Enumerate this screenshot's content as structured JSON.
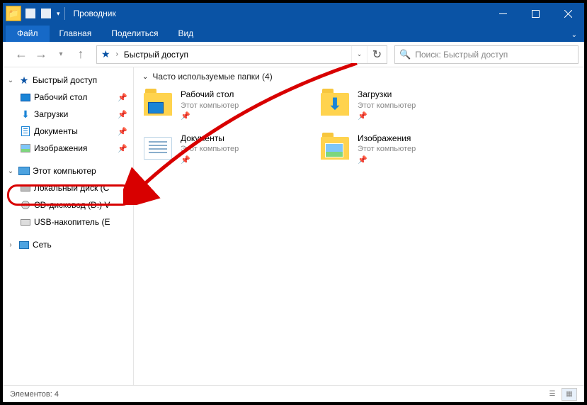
{
  "titlebar": {
    "title": "Проводник"
  },
  "menubar": {
    "file": "Файл",
    "tabs": [
      "Главная",
      "Поделиться",
      "Вид"
    ]
  },
  "nav": {
    "crumb": "Быстрый доступ",
    "search_placeholder": "Поиск: Быстрый доступ"
  },
  "sidebar": {
    "quick_access": "Быстрый доступ",
    "quick_items": [
      {
        "label": "Рабочий стол"
      },
      {
        "label": "Загрузки"
      },
      {
        "label": "Документы"
      },
      {
        "label": "Изображения"
      }
    ],
    "this_pc": "Этот компьютер",
    "pc_items": [
      {
        "label": "Локальный диск (C"
      },
      {
        "label": "CD-дисковод (D:) V"
      },
      {
        "label": "USB-накопитель (E"
      }
    ],
    "network": "Сеть"
  },
  "content": {
    "section_label": "Часто используемые папки (4)",
    "tiles": [
      {
        "title": "Рабочий стол",
        "sub": "Этот компьютер"
      },
      {
        "title": "Загрузки",
        "sub": "Этот компьютер"
      },
      {
        "title": "Документы",
        "sub": "Этот компьютер"
      },
      {
        "title": "Изображения",
        "sub": "Этот компьютер"
      }
    ]
  },
  "statusbar": {
    "count_label": "Элементов: 4"
  }
}
